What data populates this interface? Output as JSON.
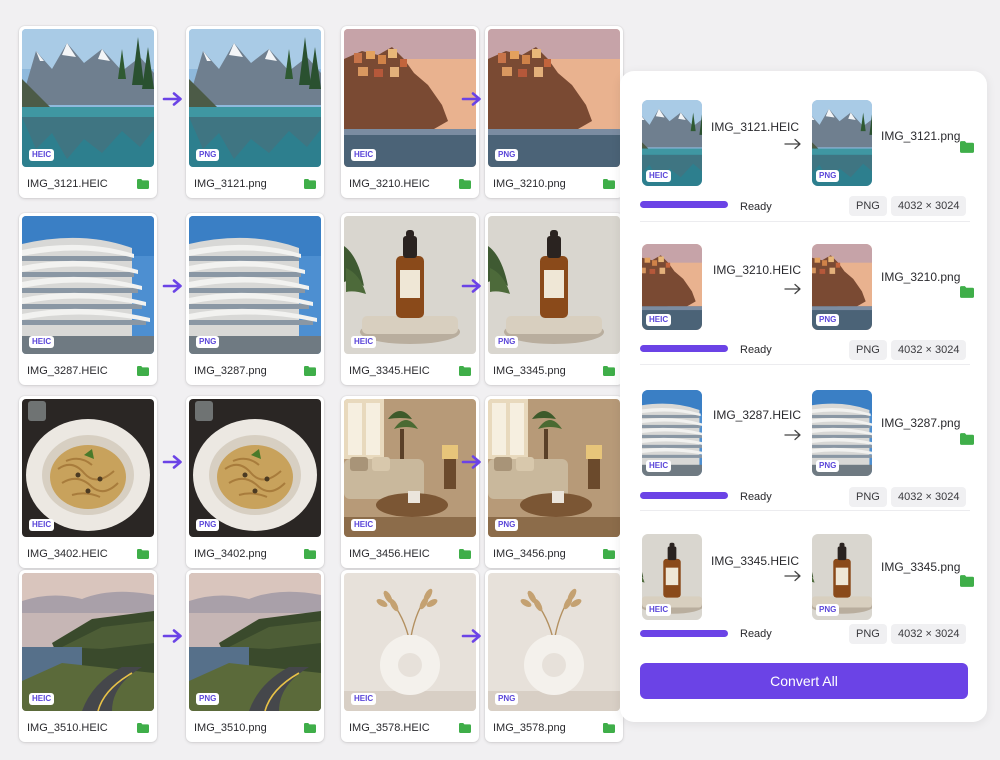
{
  "grid": {
    "rows": [
      {
        "src_name": "IMG_3121.HEIC",
        "dst_name": "IMG_3121.png",
        "src_name2": "IMG_3210.HEIC",
        "dst_name2": "IMG_3210.png"
      },
      {
        "src_name": "IMG_3287.HEIC",
        "dst_name": "IMG_3287.png",
        "src_name2": "IMG_3345.HEIC",
        "dst_name2": "IMG_3345.png"
      },
      {
        "src_name": "IMG_3402.HEIC",
        "dst_name": "IMG_3402.png",
        "src_name2": "IMG_3456.HEIC",
        "dst_name2": "IMG_3456.png"
      },
      {
        "src_name": "IMG_3510.HEIC",
        "dst_name": "IMG_3510.png",
        "src_name2": "IMG_3578.HEIC",
        "dst_name2": "IMG_3578.png"
      }
    ],
    "badge_src": "HEIC",
    "badge_dst": "PNG"
  },
  "panel": {
    "items": [
      {
        "src": "IMG_3121.HEIC",
        "dst": "IMG_3121.png",
        "status": "Ready",
        "format": "PNG",
        "dims": "4032 × 3024",
        "progress": 1.0
      },
      {
        "src": "IMG_3210.HEIC",
        "dst": "IMG_3210.png",
        "status": "Ready",
        "format": "PNG",
        "dims": "4032 × 3024",
        "progress": 1.0
      },
      {
        "src": "IMG_3287.HEIC",
        "dst": "IMG_3287.png",
        "status": "Ready",
        "format": "PNG",
        "dims": "4032 × 3024",
        "progress": 1.0
      },
      {
        "src": "IMG_3345.HEIC",
        "dst": "IMG_3345.png",
        "status": "Ready",
        "format": "PNG",
        "dims": "4032 × 3024",
        "progress": 1.0
      }
    ],
    "convert_label": "Convert All"
  },
  "colors": {
    "accent": "#6b43e6",
    "folder": "#3fae49",
    "badge_text": "#5b46d9"
  }
}
